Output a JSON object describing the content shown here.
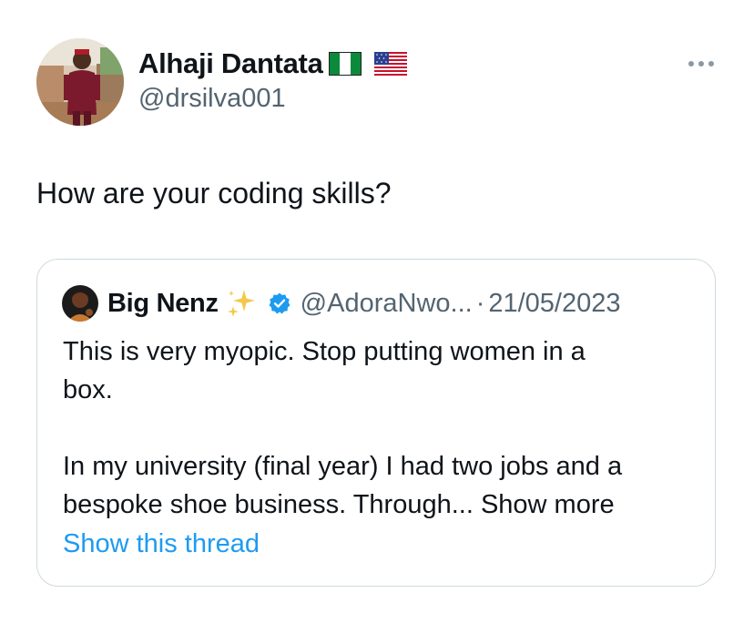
{
  "tweet": {
    "author": {
      "display_name": "Alhaji Dantata",
      "handle": "@drsilva001",
      "flags": [
        "nigeria-flag-icon",
        "us-flag-icon"
      ]
    },
    "more_icon": "more-horizontal-icon",
    "text": "How are your coding skills?"
  },
  "quote": {
    "author": {
      "display_name": "Big Nenz",
      "emoji": "sparkles-icon",
      "verified_icon": "verified-badge-icon",
      "handle": "@AdoraNwo...",
      "separator": "·",
      "date": "21/05/2023"
    },
    "body": {
      "line1": "This is very myopic. Stop putting women in a",
      "line2": "box.",
      "line3": "In my university (final year) I had two jobs and a",
      "line4_text": "bespoke shoe business. Through... ",
      "show_more": "Show more"
    },
    "show_thread": "Show this thread"
  },
  "colors": {
    "text_primary": "#0f1419",
    "text_secondary": "#536471",
    "link_blue": "#1d9bf0",
    "border": "#cfd9de",
    "verified_blue": "#1d9bf0"
  }
}
